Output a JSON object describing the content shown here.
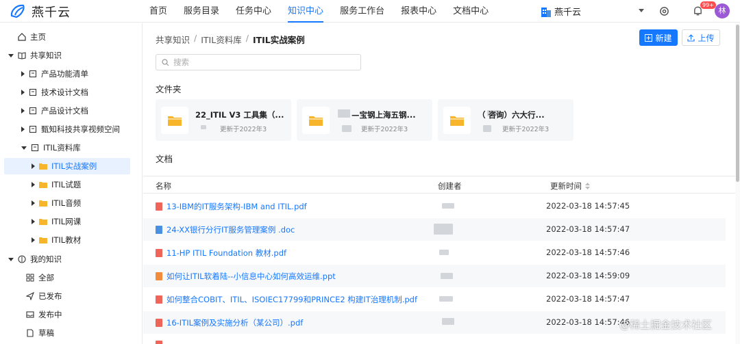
{
  "app": {
    "name": "燕千云",
    "org": "燕千云",
    "notifications": "99+",
    "avatar": "林"
  },
  "nav": [
    "首页",
    "服务目录",
    "任务中心",
    "知识中心",
    "服务工作台",
    "报表中心",
    "文档中心"
  ],
  "nav_active": "知识中心",
  "sidebar": {
    "home": "主页",
    "shared": "共享知识",
    "shared_items": [
      "产品功能清单",
      "技术设计文档",
      "产品设计文档",
      "甄知科技共享视频空间",
      "ITIL资料库"
    ],
    "itil_items": [
      "ITIL实战案例",
      "ITIL试题",
      "ITIL音频",
      "ITIL网课",
      "ITIL教材"
    ],
    "mine": "我的知识",
    "mine_items": [
      "全部",
      "已发布",
      "发布中",
      "草稿"
    ]
  },
  "breadcrumb": [
    "共享知识",
    "ITIL资料库",
    "ITIL实战案例"
  ],
  "breadcrumb_sep": "/",
  "actions": {
    "new": "新建",
    "upload": "上传"
  },
  "search": {
    "placeholder": "搜索"
  },
  "folders_title": "文件夹",
  "folders": [
    {
      "name": "22_ITIL V3 工具集（...",
      "meta": "更新于2022年3"
    },
    {
      "name": "—宝钢上海五钢...",
      "meta": "更新于2022年3"
    },
    {
      "name": "（    咨询）六大行...",
      "meta": "更新于2022年3"
    }
  ],
  "docs_title": "文档",
  "columns": {
    "name": "名称",
    "creator": "创建者",
    "updated": "更新时间"
  },
  "docs": [
    {
      "name": "13-IBM的IT服务架构-IBM and ITIL.pdf",
      "type": "pdf",
      "time": "2022-03-18 14:57:45"
    },
    {
      "name": "24-XX银行分行IT服务管理案例 .doc",
      "type": "doc",
      "time": "2022-03-18 14:57:47"
    },
    {
      "name": "11-HP ITIL Foundation 教材.pdf",
      "type": "pdf",
      "time": "2022-03-18 14:57:46"
    },
    {
      "name": "如何让ITIL软着陆--小信息中心如何高效运维.ppt",
      "type": "ppt",
      "time": "2022-03-18 14:59:09"
    },
    {
      "name": "如何整合COBIT、ITIL、ISOIEC17799和PRINCE2 构建IT治理机制.pdf",
      "type": "pdf",
      "time": "2022-03-18 14:57:47"
    },
    {
      "name": "16-ITIL案例及实施分析（某公司）.pdf",
      "type": "pdf",
      "time": "2022-03-18 14:57:46"
    }
  ],
  "watermark": "@稀土掘金技术社区"
}
